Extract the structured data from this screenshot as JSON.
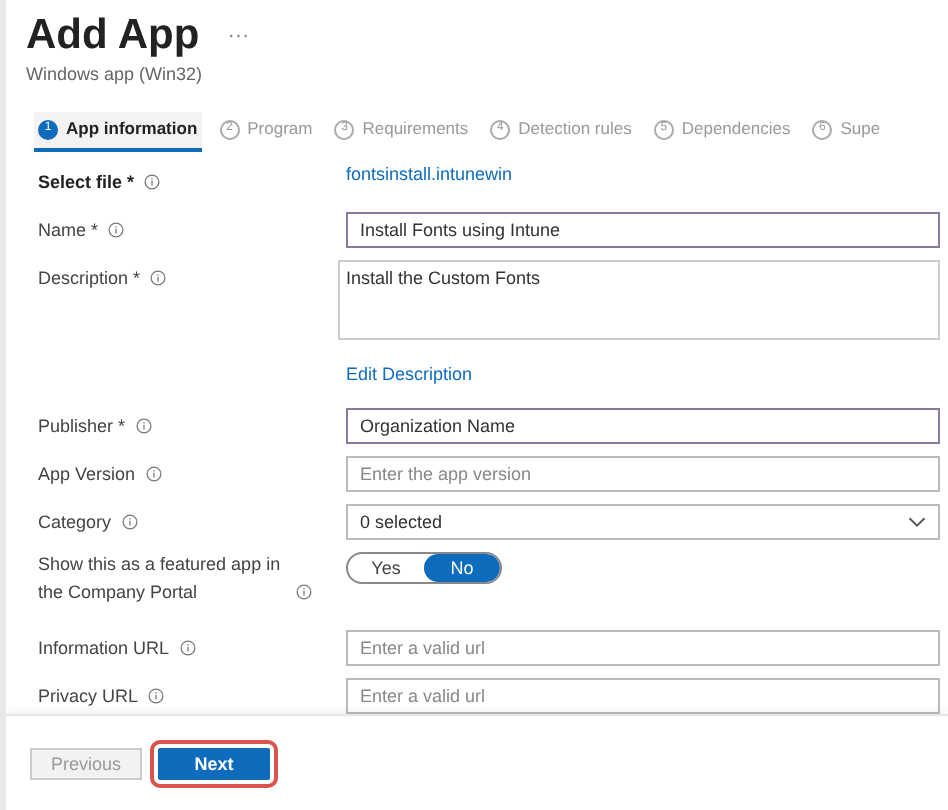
{
  "header": {
    "title": "Add App",
    "more": "···",
    "subtitle": "Windows app (Win32)"
  },
  "tabs": [
    {
      "number": "1",
      "label": "App information",
      "selected": true
    },
    {
      "number": "2",
      "label": "Program",
      "selected": false
    },
    {
      "number": "3",
      "label": "Requirements",
      "selected": false
    },
    {
      "number": "4",
      "label": "Detection rules",
      "selected": false
    },
    {
      "number": "5",
      "label": "Dependencies",
      "selected": false
    },
    {
      "number": "6",
      "label": "Supe",
      "selected": false
    }
  ],
  "fields": [
    {
      "kind": "link",
      "label": "Select file *",
      "value": "fontsinstall.intunewin"
    },
    {
      "kind": "text",
      "label": "Name *",
      "value": "Install Fonts using Intune"
    },
    {
      "kind": "textarea",
      "label": "Description *",
      "value": "Install the Custom Fonts",
      "action": "Edit Description"
    },
    {
      "kind": "text",
      "label": "Publisher *",
      "value": "Organization Name"
    },
    {
      "kind": "text",
      "label": "App Version",
      "placeholder": "Enter the app version"
    },
    {
      "kind": "select",
      "label": "Category",
      "value": "0 selected"
    },
    {
      "kind": "toggle",
      "label": "Show this as a featured app in the Company Portal",
      "options": [
        {
          "label": "Yes",
          "selected": false
        },
        {
          "label": "No",
          "selected": true
        }
      ]
    },
    {
      "kind": "text",
      "label": "Information URL",
      "placeholder": "Enter a valid url"
    },
    {
      "kind": "text",
      "label": "Privacy URL",
      "placeholder": "Enter a valid url"
    }
  ],
  "footer": {
    "buttons": [
      {
        "label": "Previous",
        "disabled": true
      },
      {
        "label": "Next",
        "disabled": false
      }
    ]
  }
}
